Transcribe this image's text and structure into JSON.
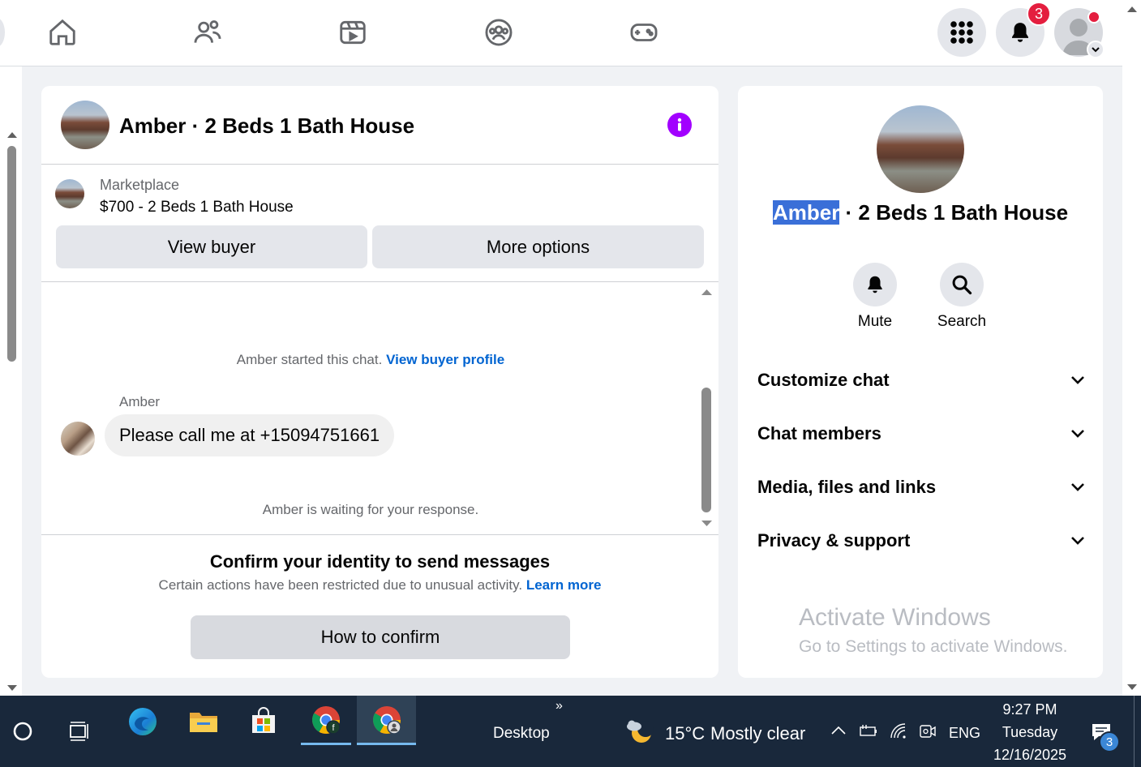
{
  "nav": {
    "notification_count": "3",
    "icons": [
      "home-icon",
      "friends-icon",
      "video-icon",
      "groups-icon",
      "gaming-icon"
    ]
  },
  "chat": {
    "title": "Amber · 2 Beds 1 Bath House",
    "listing_source": "Marketplace",
    "listing_title": "$700 - 2 Beds 1 Bath House",
    "view_buyer_label": "View buyer",
    "more_options_label": "More options",
    "started_text": "Amber started this chat.",
    "view_profile_link": "View buyer profile",
    "sender_name": "Amber",
    "message_text": "Please call me at +15094751661",
    "waiting_text": "Amber is waiting for your response.",
    "confirm_title": "Confirm your identity to send messages",
    "confirm_desc": "Certain actions have been restricted due to unusual activity.",
    "learn_more": "Learn more",
    "how_to_confirm": "How to confirm"
  },
  "info": {
    "name_highlight": "Amber",
    "name_rest": " · 2 Beds 1 Bath House",
    "mute_label": "Mute",
    "search_label": "Search",
    "sections": [
      "Customize chat",
      "Chat members",
      "Media, files and links",
      "Privacy & support"
    ],
    "activate_title": "Activate Windows",
    "activate_sub": "Go to Settings to activate Windows."
  },
  "taskbar": {
    "desktop_label": "Desktop",
    "weather_temp": "15°C",
    "weather_desc": "Mostly clear",
    "lang": "ENG",
    "time": "9:27 PM",
    "day": "Tuesday",
    "date": "12/16/2025",
    "notif_count": "3"
  },
  "colors": {
    "accent": "#0064d1",
    "badge": "#e41e3f",
    "info_icon": "#a200ff",
    "highlight": "#3a6fd8"
  }
}
